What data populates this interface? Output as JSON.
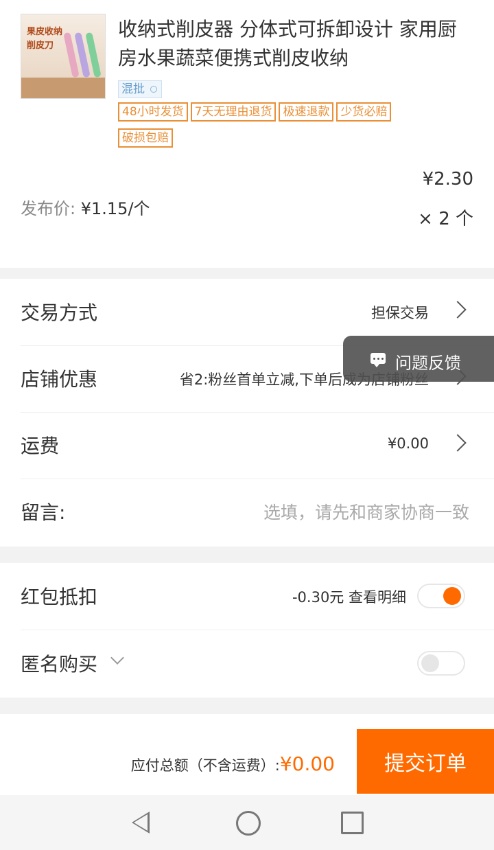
{
  "product": {
    "image_text_line1": "果皮收纳",
    "image_text_line2": "削皮刀",
    "title": "收纳式削皮器 分体式可拆卸设计 家用厨房水果蔬菜便携式削皮收纳",
    "pifa_tag": "混批",
    "service_tags": [
      "48小时发货",
      "7天无理由退货",
      "极速退款",
      "少货必赔",
      "破损包赔"
    ],
    "publish_price_label": "发布价:",
    "publish_price": "¥1.15/个",
    "total_price": "¥2.30",
    "quantity": "× 2 个"
  },
  "order": {
    "trade_method": {
      "label": "交易方式",
      "value": "担保交易"
    },
    "shop_discount": {
      "label": "店铺优惠",
      "value": "省2:粉丝首单立减,下单后成为店铺粉丝"
    },
    "shipping": {
      "label": "运费",
      "value": "¥0.00"
    },
    "message": {
      "label": "留言:",
      "placeholder": "选填，请先和商家协商一致"
    }
  },
  "options": {
    "red_packet": {
      "label": "红包抵扣",
      "amount": "-0.30元",
      "detail": "查看明细",
      "enabled": true
    },
    "anonymous": {
      "label": "匿名购买",
      "enabled": false
    }
  },
  "feedback": {
    "label": "问题反馈"
  },
  "footer": {
    "total_label": "应付总额（不含运费）:",
    "total_amount": "¥0.00",
    "submit_label": "提交订单"
  },
  "colors": {
    "accent": "#ff6a00",
    "tag_orange": "#e98f36"
  }
}
